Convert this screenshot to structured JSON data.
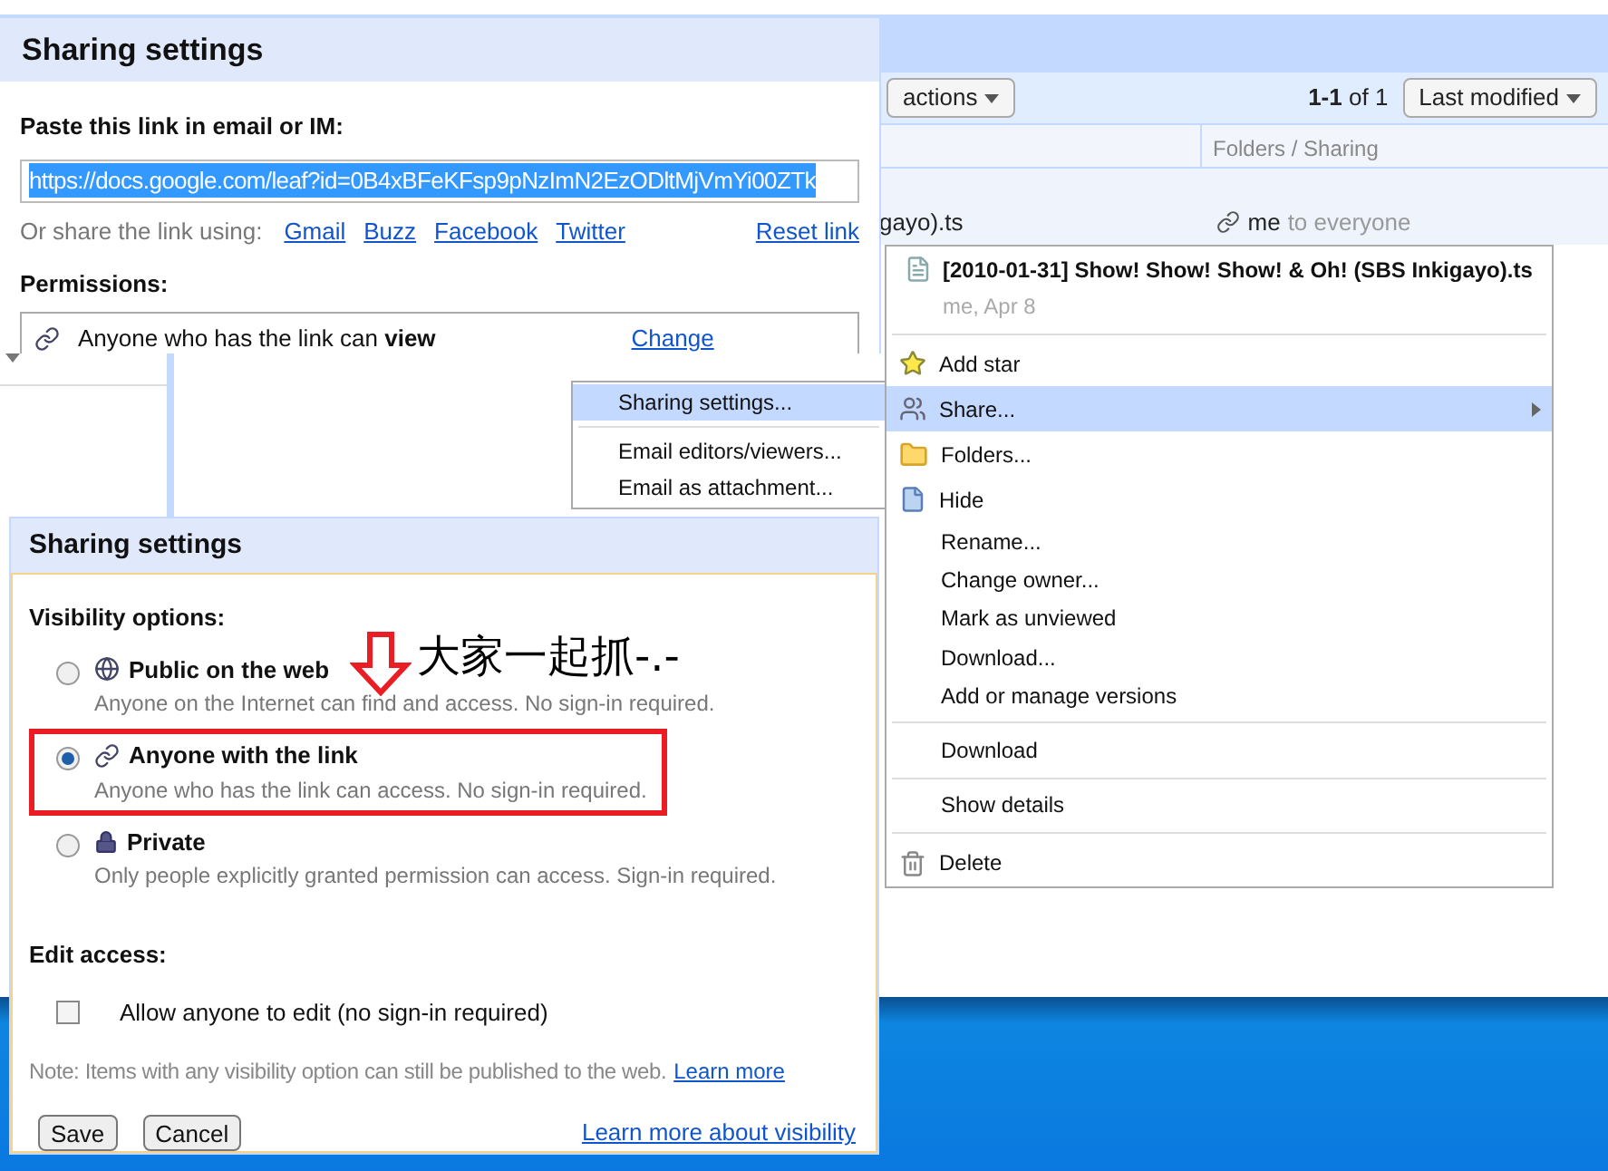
{
  "background_app": {
    "actions_button": "actions",
    "page_count": "**1-1** of 1",
    "sort_button": "Last modified",
    "column_header": "Folders / Sharing",
    "file_name": "gayo).ts",
    "sharing_owner": "me",
    "sharing_rest": "to everyone"
  },
  "link_dialog": {
    "title": "Sharing settings",
    "link_label": "Paste this link in email or IM:",
    "link_value": "https://docs.google.com/leaf?id=0B4xBFeKFsp9pNzImN2EzODltMjVmYi00ZTk",
    "share_label": "Or share the link using:",
    "share_links": [
      "Gmail",
      "Buzz",
      "Facebook",
      "Twitter"
    ],
    "reset_link": "Reset link",
    "permissions_label": "Permissions:",
    "permission": "Anyone who has the link can **view**",
    "change_link": "Change"
  },
  "share_submenu": {
    "groups": [
      [
        {
          "label": "Sharing settings...",
          "selected": true
        }
      ],
      [
        {
          "label": "Email editors/viewers...",
          "selected": false
        },
        {
          "label": "Email as attachment...",
          "selected": false
        }
      ]
    ]
  },
  "context_menu": {
    "file_title": "[2010-01-31] Show! Show! Show! & Oh! (SBS Inkigayo).ts",
    "file_meta": "me, Apr 8",
    "groups": [
      [
        {
          "label": "Add star",
          "kind": "star",
          "selected": false,
          "has_submenu": false
        },
        {
          "label": "Share...",
          "kind": "share",
          "selected": true,
          "has_submenu": true
        },
        {
          "label": "Folders...",
          "kind": "folder",
          "selected": false,
          "has_submenu": false
        },
        {
          "label": "Hide",
          "kind": "hide",
          "selected": false,
          "has_submenu": false
        },
        {
          "label": "Rename...",
          "kind": "plain",
          "selected": false,
          "has_submenu": false
        },
        {
          "label": "Change owner...",
          "kind": "plain",
          "selected": false,
          "has_submenu": false
        },
        {
          "label": "Mark as unviewed",
          "kind": "plain",
          "selected": false,
          "has_submenu": false
        },
        {
          "label": "Download...",
          "kind": "plain",
          "selected": false,
          "has_submenu": false
        },
        {
          "label": "Add or manage versions",
          "kind": "plain",
          "selected": false,
          "has_submenu": false
        }
      ],
      [
        {
          "label": "Download",
          "kind": "plain",
          "selected": false,
          "has_submenu": false
        }
      ],
      [
        {
          "label": "Show details",
          "kind": "plain",
          "selected": false,
          "has_submenu": false
        }
      ],
      [
        {
          "label": "Delete",
          "kind": "delete",
          "selected": false,
          "has_submenu": false
        }
      ]
    ]
  },
  "visibility_dialog": {
    "title": "Sharing settings",
    "visibility_label": "Visibility options:",
    "options": [
      {
        "kind": "globe",
        "title": "Public on the web",
        "description": "Anyone on the Internet can find and access. No sign-in required.",
        "selected": false,
        "highlighted": false
      },
      {
        "kind": "link",
        "title": "Anyone with the link",
        "description": "Anyone who has the link can access. No sign-in required.",
        "selected": true,
        "highlighted": true
      },
      {
        "kind": "lock",
        "title": "Private",
        "description": "Only people explicitly granted permission can access. Sign-in required.",
        "selected": false,
        "highlighted": false
      }
    ],
    "edit_label": "Edit access:",
    "edit_option": {
      "label": "Allow anyone to edit (no sign-in required)",
      "checked": false
    },
    "note": "Note: Items with any visibility option can still be published to the web.",
    "note_link": "Learn more",
    "buttons": [
      "Save",
      "Cancel"
    ],
    "visibility_link": "Learn more about visibility"
  },
  "annotation": {
    "caption": "大家一起抓-.-"
  }
}
